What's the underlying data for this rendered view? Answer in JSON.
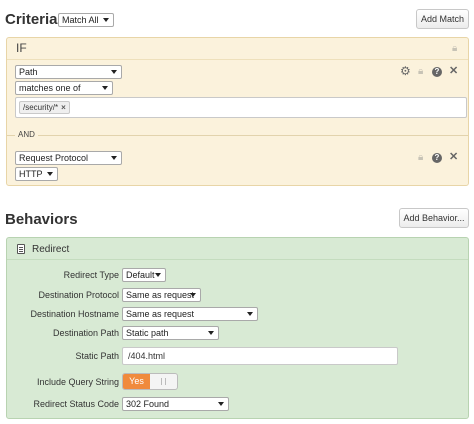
{
  "criteria": {
    "title": "Criteria",
    "match_mode": "Match All",
    "add_button": "Add Match",
    "if_label": "IF",
    "rule1": {
      "field": "Path",
      "operator": "matches one of",
      "tags": [
        "/security/*"
      ]
    },
    "and_label": "AND",
    "rule2": {
      "field": "Request Protocol",
      "value": "HTTP"
    }
  },
  "behaviors": {
    "title": "Behaviors",
    "add_button": "Add Behavior...",
    "panel_title": "Redirect",
    "fields": {
      "redirect_type": {
        "label": "Redirect Type",
        "value": "Default"
      },
      "destination_protocol": {
        "label": "Destination Protocol",
        "value": "Same as request"
      },
      "destination_hostname": {
        "label": "Destination Hostname",
        "value": "Same as request"
      },
      "destination_path": {
        "label": "Destination Path",
        "value": "Static path"
      },
      "static_path": {
        "label": "Static Path",
        "value": "/404.html"
      },
      "include_query_string": {
        "label": "Include Query String",
        "value": "Yes"
      },
      "redirect_status_code": {
        "label": "Redirect Status Code",
        "value": "302 Found"
      }
    }
  },
  "colors": {
    "criteria_bg": "#fbf2dc",
    "behavior_bg": "#d8ead4",
    "toggle_on": "#f08a3c"
  }
}
